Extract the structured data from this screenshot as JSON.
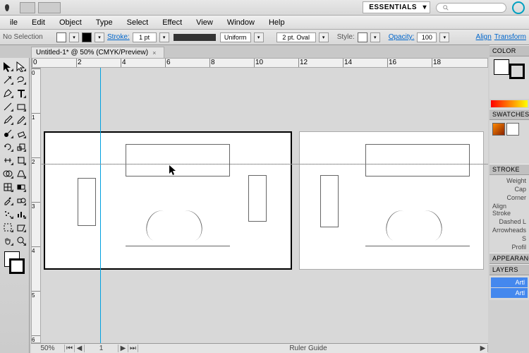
{
  "topbar": {
    "workspace_label": "ESSENTIALS"
  },
  "menus": [
    "ile",
    "Edit",
    "Object",
    "Type",
    "Select",
    "Effect",
    "View",
    "Window",
    "Help"
  ],
  "control": {
    "selection": "No Selection",
    "stroke_label": "Stroke:",
    "stroke_weight": "1 pt",
    "stroke_type": "Uniform",
    "brush": "2 pt. Oval",
    "style_label": "Style:",
    "opacity_label": "Opacity:",
    "opacity_value": "100",
    "align_label": "Align",
    "transform_label": "Transform"
  },
  "tab": {
    "title": "Untitled-1* @ 50% (CMYK/Preview)"
  },
  "rulers_h": [
    0,
    2,
    4,
    6,
    8,
    10,
    12,
    14,
    16,
    18
  ],
  "rulers_v": [
    0,
    1,
    2,
    3,
    4,
    5,
    6
  ],
  "status": {
    "zoom": "50%",
    "artboard": "1",
    "text": "Ruler Guide"
  },
  "panels": {
    "color": "COLOR",
    "swatches": "SWATCHES",
    "stroke": "STROKE",
    "stroke_rows": [
      "Weight",
      "Cap",
      "Corner",
      "Align Stroke",
      "Dashed L",
      "Arrowheads",
      "S",
      "Profil"
    ],
    "appearance": "APPEARANC",
    "layers": "LAYERS",
    "layer_items": [
      "Artl",
      "Artl"
    ]
  },
  "tools": [
    [
      "selection",
      "direct-selection"
    ],
    [
      "magic-wand",
      "lasso"
    ],
    [
      "pen",
      "type"
    ],
    [
      "line",
      "rectangle"
    ],
    [
      "brush",
      "pencil"
    ],
    [
      "blob-brush",
      "eraser"
    ],
    [
      "rotate",
      "scale"
    ],
    [
      "width",
      "free-transform"
    ],
    [
      "shape-builder",
      "perspective"
    ],
    [
      "mesh",
      "gradient"
    ],
    [
      "eyedropper",
      "blend"
    ],
    [
      "symbol-sprayer",
      "column-graph"
    ],
    [
      "artboard",
      "slice"
    ],
    [
      "hand",
      "zoom"
    ]
  ]
}
